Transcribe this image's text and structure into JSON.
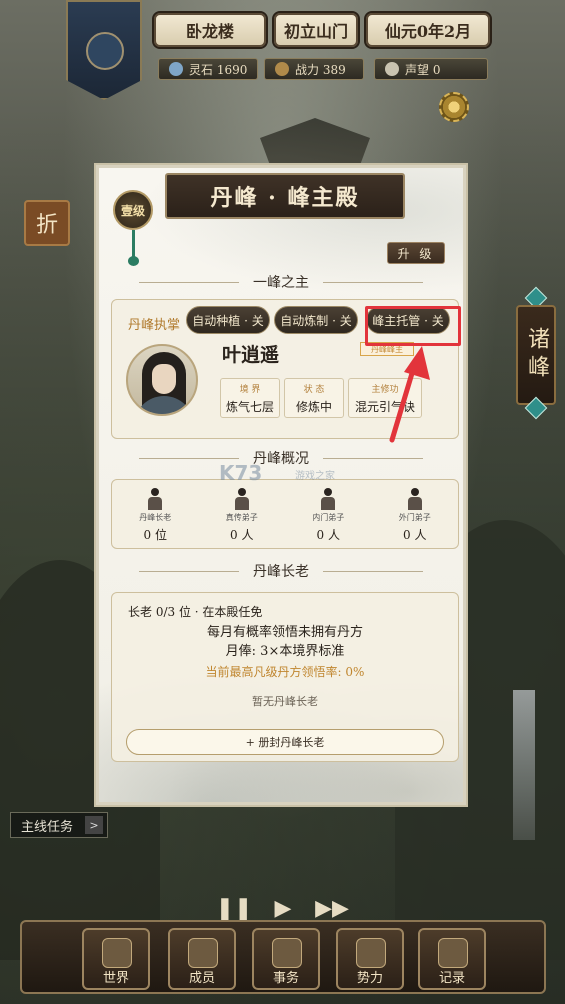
{
  "topbar": {
    "sect_name": "卧龙楼",
    "stage": "初立山门",
    "date": "仙元0年2月",
    "spirit_stones": "灵石 1690",
    "combat_power": "战力 389",
    "prestige": "声望 0"
  },
  "side": {
    "fold_label": "折",
    "peaks_label": "诸峰"
  },
  "modal": {
    "title": "丹峰 · 峰主殿",
    "rank_badge": "壹级",
    "upgrade_label": "升 级",
    "section_lord": "一峰之主",
    "section_overview": "丹峰概况",
    "section_elders": "丹峰长老",
    "leader": {
      "role_label": "丹峰执掌",
      "toggles": [
        "自动种植 · 关",
        "自动炼制 · 关",
        "峰主托管 · 关"
      ],
      "name": "叶逍遥",
      "role_tag": "丹峰峰主",
      "stats": [
        {
          "key": "境 界",
          "value": "炼气七层"
        },
        {
          "key": "状 态",
          "value": "修炼中"
        },
        {
          "key": "主修功",
          "value": "混元引气诀"
        }
      ]
    },
    "overview": [
      {
        "label": "丹峰长老",
        "count": "0 位"
      },
      {
        "label": "真传弟子",
        "count": "0 人"
      },
      {
        "label": "内门弟子",
        "count": "0 人"
      },
      {
        "label": "外门弟子",
        "count": "0 人"
      }
    ],
    "elders": {
      "header": "长老 0/3 位 · 在本殿任免",
      "line1": "每月有概率领悟未拥有丹方",
      "line2": "月俸: 3×本境界标准",
      "rate": "当前最高凡级丹方领悟率: 0%",
      "none": "暂无丹峰长老",
      "appoint_button": "+ 册封丹峰长老"
    }
  },
  "watermark": {
    "logo": "K73",
    "text": "游戏之家"
  },
  "quest": {
    "label": "主线任务",
    "arrow": ">"
  },
  "playback": {
    "pause": "❚❚",
    "play": "▶",
    "fast": "▶▶"
  },
  "nav": [
    "世界",
    "成员",
    "事务",
    "势力",
    "记录"
  ],
  "colors": {
    "highlight": "#e2343b",
    "accent": "#b07a2c"
  }
}
